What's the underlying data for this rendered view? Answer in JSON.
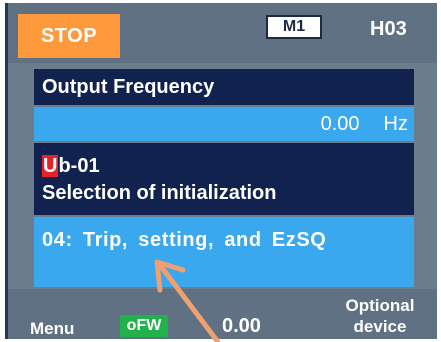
{
  "header": {
    "status": "STOP",
    "mode": "M1",
    "code": "H03"
  },
  "monitor": {
    "label": "Output Frequency",
    "value": "0.00",
    "unit": "Hz"
  },
  "parameter": {
    "code_first_char": "U",
    "code_rest": "b-01",
    "name": "Selection of initialization"
  },
  "setting": {
    "value": "04: Trip, setting, and EzSQ"
  },
  "footer": {
    "menu_label": "Menu",
    "badge": "oFW",
    "value": "0.00",
    "optional_line1": "Optional",
    "optional_line2": "device"
  },
  "colors": {
    "stop_bg": "#ff9a3c",
    "dark_panel": "#10224d",
    "light_panel": "#3aa8ee",
    "highlight_red": "#e8202a",
    "badge_green": "#22b24c",
    "arrow": "#f0a070"
  }
}
